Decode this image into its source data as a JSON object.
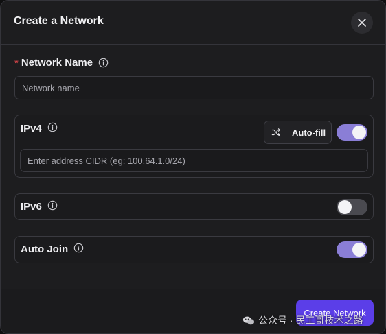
{
  "dialog": {
    "title": "Create a Network",
    "close_icon": "close-icon"
  },
  "network_name": {
    "required_mark": "*",
    "label": "Network Name",
    "placeholder": "Network name",
    "value": ""
  },
  "ipv4": {
    "label": "IPv4",
    "autofill_label": "Auto-fill",
    "autofill_icon": "shuffle-icon",
    "enabled": true,
    "cidr_placeholder": "Enter address CIDR (eg: 100.64.1.0/24)",
    "cidr_value": ""
  },
  "ipv6": {
    "label": "IPv6",
    "enabled": false
  },
  "auto_join": {
    "label": "Auto Join",
    "enabled": true
  },
  "footer": {
    "create_label": "Create Network"
  },
  "watermark": {
    "text": "公众号 · 民工哥技术之路"
  },
  "colors": {
    "background": "#1d1d1f",
    "accent": "#5b3ee8",
    "toggle_on": "#8a7ed6",
    "toggle_off": "#4a4a50",
    "required": "#e5484d"
  }
}
